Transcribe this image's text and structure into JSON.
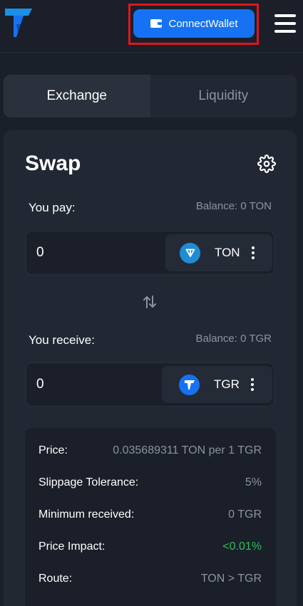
{
  "header": {
    "connect_label": "ConnectWallet"
  },
  "tabs": [
    {
      "label": "Exchange",
      "active": true
    },
    {
      "label": "Liquidity",
      "active": false
    }
  ],
  "swap": {
    "title": "Swap",
    "pay": {
      "label": "You pay:",
      "balance": "Balance: 0 TON",
      "amount": "0",
      "token": "TON"
    },
    "receive": {
      "label": "You receive:",
      "balance": "Balance: 0 TGR",
      "amount": "0",
      "token": "TGR"
    }
  },
  "info": {
    "rows": [
      {
        "key": "Price:",
        "value": "0.035689311 TON per 1 TGR"
      },
      {
        "key": "Slippage Tolerance:",
        "value": "5%"
      },
      {
        "key": "Minimum received:",
        "value": "0 TGR"
      },
      {
        "key": "Price Impact:",
        "value": "<0.01%"
      },
      {
        "key": "Route:",
        "value": "TON > TGR"
      }
    ]
  },
  "colors": {
    "background": "#1a1f29",
    "card": "#222833",
    "accent": "#1672f3",
    "highlight": "#e3141b",
    "positive": "#2bbf5a",
    "muted": "#8c939f"
  },
  "icons": [
    "app-logo",
    "wallet-icon",
    "menu-icon",
    "gear-icon",
    "ton-token-icon",
    "tgr-token-icon",
    "swap-arrows-icon",
    "more-vertical-icon"
  ]
}
